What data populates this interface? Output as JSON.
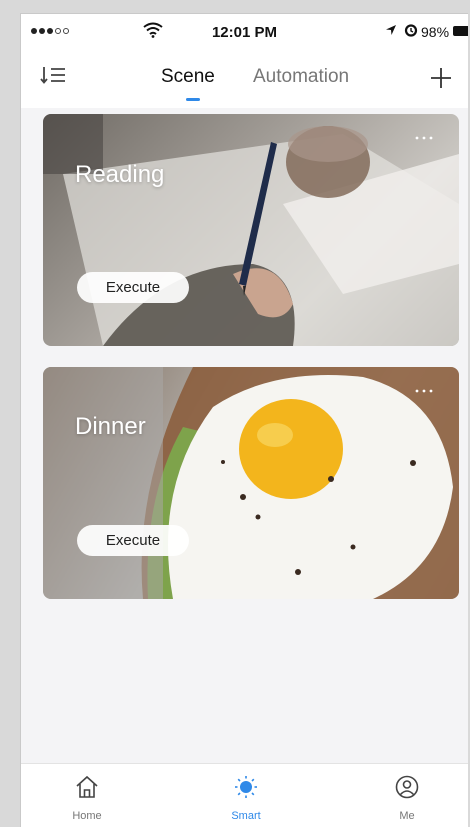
{
  "status_bar": {
    "time": "12:01 PM",
    "battery": "98%"
  },
  "header": {
    "tabs": [
      {
        "label": "Scene",
        "active": true
      },
      {
        "label": "Automation",
        "active": false
      }
    ],
    "icons": {
      "sort": "sort-list-icon",
      "add": "plus-icon"
    },
    "accent_color": "#2f89e8"
  },
  "scenes": [
    {
      "title": "Reading",
      "button_label": "Execute"
    },
    {
      "title": "Dinner",
      "button_label": "Execute"
    }
  ],
  "bottom_nav": {
    "items": [
      {
        "label": "Home",
        "icon": "home-icon",
        "active": false
      },
      {
        "label": "Smart",
        "icon": "sun-icon",
        "active": true
      },
      {
        "label": "Me",
        "icon": "person-icon",
        "active": false
      }
    ]
  }
}
